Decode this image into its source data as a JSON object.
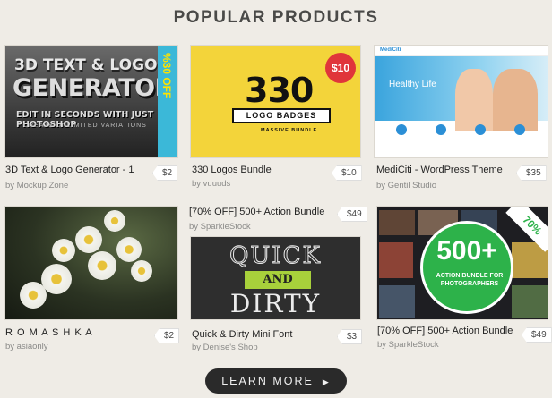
{
  "heading": "POPULAR PRODUCTS",
  "products": [
    {
      "title": "3D Text & Logo Generator - 1",
      "author": "by Mockup Zone",
      "price": "$2",
      "thumb": {
        "line1": "3D TEXT & LOGO",
        "line2": "GENERATOR",
        "line3": "EDIT IN SECONDS WITH JUST PHOTOSHOP",
        "line4": "CREATE UNLIMITED VARIATIONS",
        "badge": "%30 OFF"
      }
    },
    {
      "title": "330 Logos Bundle",
      "author": "by vuuuds",
      "price": "$10",
      "thumb": {
        "number": "330",
        "banner": "LOGO BADGES",
        "sub": "MASSIVE BUNDLE",
        "badge": "$10"
      }
    },
    {
      "title": "MediCiti - WordPress Theme",
      "author": "by Gentil Studio",
      "price": "$35",
      "thumb": {
        "logo": "MediCiti",
        "hero": "Healthy Life"
      }
    },
    {
      "title": "R O M A S H K A",
      "author": "by asiaonly",
      "price": "$2"
    },
    {
      "title": "Quick & Dirty Mini Font",
      "author": "by Denise's Shop",
      "price": "$3",
      "overline_title": "[70% OFF] 500+ Action Bundle",
      "overline_author": "by SparkleStock",
      "overline_price": "$49",
      "thumb": {
        "line1": "QUICK",
        "line2": "AND",
        "line3": "DIRTY"
      }
    },
    {
      "title": "[70% OFF] 500+ Action Bundle",
      "author": "by SparkleStock",
      "price": "$49",
      "thumb": {
        "big": "500+",
        "small": "ACTION BUNDLE FOR PHOTOGRAPHERS",
        "ribbon": "70%"
      }
    }
  ],
  "learn_more": "LEARN MORE",
  "colors": {
    "background": "#efece6",
    "button": "#2a2a2a",
    "accent_green": "#2db24a"
  }
}
